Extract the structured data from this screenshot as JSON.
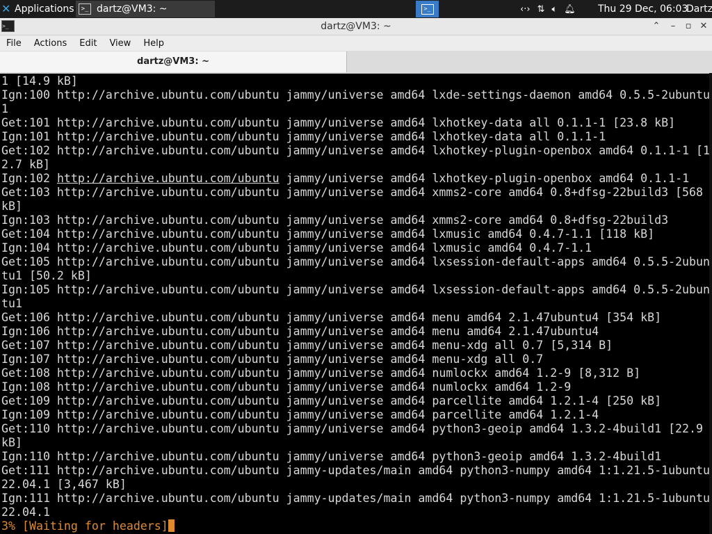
{
  "panel": {
    "applications_label": "Applications",
    "task_label": "dartz@VM3: ~",
    "clock": "Thu 29 Dec, 06:03",
    "user": "Dartz"
  },
  "window": {
    "title": "dartz@VM3: ~"
  },
  "menu": [
    "File",
    "Actions",
    "Edit",
    "View",
    "Help"
  ],
  "tab": {
    "label": "dartz@VM3: ~"
  },
  "terminal": {
    "lines": [
      "1 [14.9 kB]",
      "Ign:100 http://archive.ubuntu.com/ubuntu jammy/universe amd64 lxde-settings-daemon amd64 0.5.5-2ubuntu",
      "1",
      "Get:101 http://archive.ubuntu.com/ubuntu jammy/universe amd64 lxhotkey-data all 0.1.1-1 [23.8 kB]",
      "Ign:101 http://archive.ubuntu.com/ubuntu jammy/universe amd64 lxhotkey-data all 0.1.1-1",
      "Get:102 http://archive.ubuntu.com/ubuntu jammy/universe amd64 lxhotkey-plugin-openbox amd64 0.1.1-1 [1",
      "2.7 kB]",
      "Ign:102 http://archive.ubuntu.com/ubuntu jammy/universe amd64 lxhotkey-plugin-openbox amd64 0.1.1-1",
      "Get:103 http://archive.ubuntu.com/ubuntu jammy/universe amd64 xmms2-core amd64 0.8+dfsg-22build3 [568",
      "kB]",
      "Ign:103 http://archive.ubuntu.com/ubuntu jammy/universe amd64 xmms2-core amd64 0.8+dfsg-22build3",
      "Get:104 http://archive.ubuntu.com/ubuntu jammy/universe amd64 lxmusic amd64 0.4.7-1.1 [118 kB]",
      "Ign:104 http://archive.ubuntu.com/ubuntu jammy/universe amd64 lxmusic amd64 0.4.7-1.1",
      "Get:105 http://archive.ubuntu.com/ubuntu jammy/universe amd64 lxsession-default-apps amd64 0.5.5-2ubun",
      "tu1 [50.2 kB]",
      "Ign:105 http://archive.ubuntu.com/ubuntu jammy/universe amd64 lxsession-default-apps amd64 0.5.5-2ubun",
      "tu1",
      "Get:106 http://archive.ubuntu.com/ubuntu jammy/universe amd64 menu amd64 2.1.47ubuntu4 [354 kB]",
      "Ign:106 http://archive.ubuntu.com/ubuntu jammy/universe amd64 menu amd64 2.1.47ubuntu4",
      "Get:107 http://archive.ubuntu.com/ubuntu jammy/universe amd64 menu-xdg all 0.7 [5,314 B]",
      "Ign:107 http://archive.ubuntu.com/ubuntu jammy/universe amd64 menu-xdg all 0.7",
      "Get:108 http://archive.ubuntu.com/ubuntu jammy/universe amd64 numlockx amd64 1.2-9 [8,312 B]",
      "Ign:108 http://archive.ubuntu.com/ubuntu jammy/universe amd64 numlockx amd64 1.2-9",
      "Get:109 http://archive.ubuntu.com/ubuntu jammy/universe amd64 parcellite amd64 1.2.1-4 [250 kB]",
      "Ign:109 http://archive.ubuntu.com/ubuntu jammy/universe amd64 parcellite amd64 1.2.1-4",
      "Get:110 http://archive.ubuntu.com/ubuntu jammy/universe amd64 python3-geoip amd64 1.3.2-4build1 [22.9",
      "kB]",
      "Ign:110 http://archive.ubuntu.com/ubuntu jammy/universe amd64 python3-geoip amd64 1.3.2-4build1",
      "Get:111 http://archive.ubuntu.com/ubuntu jammy-updates/main amd64 python3-numpy amd64 1:1.21.5-1ubuntu",
      "22.04.1 [3,467 kB]",
      "Ign:111 http://archive.ubuntu.com/ubuntu jammy-updates/main amd64 python3-numpy amd64 1:1.21.5-1ubuntu",
      "22.04.1"
    ],
    "hovered_link_line": 7,
    "hovered_link_text": "http://archive.ubuntu.com/ubuntu",
    "progress_line": "3% [Waiting for headers]",
    "progress_color": "#e08a2e"
  }
}
